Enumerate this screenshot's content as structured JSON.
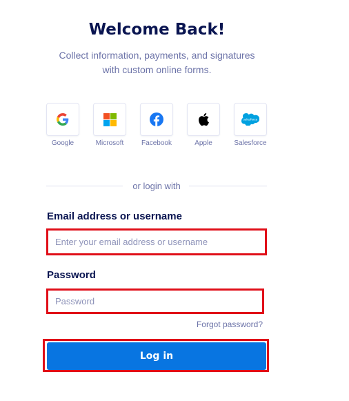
{
  "header": {
    "title": "Welcome Back!",
    "subtitle_line1": "Collect information, payments, and signatures",
    "subtitle_line2": "with custom online forms."
  },
  "social": [
    {
      "label": "Google",
      "icon": "google-icon"
    },
    {
      "label": "Microsoft",
      "icon": "microsoft-icon"
    },
    {
      "label": "Facebook",
      "icon": "facebook-icon"
    },
    {
      "label": "Apple",
      "icon": "apple-icon"
    },
    {
      "label": "Salesforce",
      "icon": "salesforce-icon"
    }
  ],
  "salesforce_logo_text": "salesforce",
  "divider": {
    "text": "or login with"
  },
  "email": {
    "label": "Email address or username",
    "placeholder": "Enter your email address or username",
    "value": ""
  },
  "password": {
    "label": "Password",
    "placeholder": "Password",
    "value": ""
  },
  "forgot_password": "Forgot password?",
  "login_button": "Log in",
  "colors": {
    "title": "#0a1551",
    "muted": "#6c73a8",
    "primary": "#0875e1",
    "highlight": "#e00e18"
  }
}
